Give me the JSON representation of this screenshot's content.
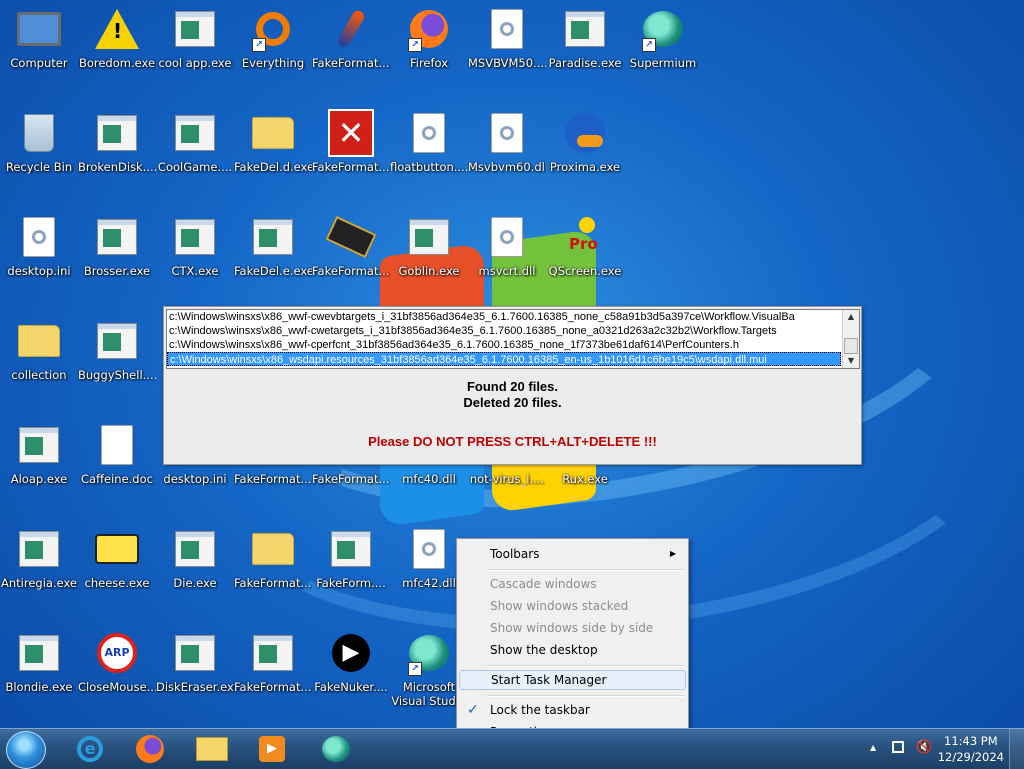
{
  "desktop": {
    "icons": [
      {
        "label": "Computer",
        "kind": "monitor"
      },
      {
        "label": "Boredom.exe",
        "kind": "warn"
      },
      {
        "label": "cool app.exe",
        "kind": "app"
      },
      {
        "label": "Everything",
        "kind": "ring",
        "shortcut": true
      },
      {
        "label": "FakeFormat....",
        "kind": "torch"
      },
      {
        "label": "Firefox",
        "kind": "fox",
        "shortcut": true
      },
      {
        "label": "MSVBVM50....",
        "kind": "gear"
      },
      {
        "label": "Paradise.exe",
        "kind": "app"
      },
      {
        "label": "Supermium",
        "kind": "orb",
        "shortcut": true
      },
      {
        "label": "Recycle Bin",
        "kind": "bin"
      },
      {
        "label": "BrokenDisk....",
        "kind": "app"
      },
      {
        "label": "CoolGame....",
        "kind": "app"
      },
      {
        "label": "FakeDel.d.exe",
        "kind": "folder"
      },
      {
        "label": "FakeFormat....",
        "kind": "redx"
      },
      {
        "label": "floatbutton....",
        "kind": "gear"
      },
      {
        "label": "Msvbvm60.dll",
        "kind": "gear"
      },
      {
        "label": "Proxima.exe",
        "kind": "duck"
      },
      {
        "label": "desktop.ini",
        "kind": "gear"
      },
      {
        "label": "Brosser.exe",
        "kind": "app"
      },
      {
        "label": "CTX.exe",
        "kind": "app"
      },
      {
        "label": "FakeDel.e.exe",
        "kind": "app"
      },
      {
        "label": "FakeFormat....",
        "kind": "chip"
      },
      {
        "label": "Goblin.exe",
        "kind": "app"
      },
      {
        "label": "msvcrt.dll",
        "kind": "gear"
      },
      {
        "label": "QScreen.exe",
        "kind": "qscreen"
      },
      {
        "label": "collection",
        "kind": "folder"
      },
      {
        "label": "BuggyShell....",
        "kind": "app"
      },
      {
        "label": "Aloap.exe",
        "kind": "app"
      },
      {
        "label": "Caffeine.doc",
        "kind": "doc"
      },
      {
        "label": "desktop.ini",
        "kind": "gear"
      },
      {
        "label": "FakeFormat....",
        "kind": "app"
      },
      {
        "label": "FakeFormat....",
        "kind": "app"
      },
      {
        "label": "mfc40.dll",
        "kind": "gear"
      },
      {
        "label": "not-virus_i....",
        "kind": "app"
      },
      {
        "label": "Rux.exe",
        "kind": "app"
      },
      {
        "label": "Antiregia.exe",
        "kind": "app"
      },
      {
        "label": "cheese.exe",
        "kind": "cheese"
      },
      {
        "label": "Die.exe",
        "kind": "app"
      },
      {
        "label": "FakeFormat....",
        "kind": "folder"
      },
      {
        "label": "FakeForm....",
        "kind": "app"
      },
      {
        "label": "mfc42.dll",
        "kind": "gear"
      },
      {
        "label": "Blondie.exe",
        "kind": "app"
      },
      {
        "label": "CloseMouse....",
        "kind": "noentry"
      },
      {
        "label": "DiskEraser.exe",
        "kind": "app"
      },
      {
        "label": "FakeFormat....",
        "kind": "app"
      },
      {
        "label": "FakeNuker....",
        "kind": "black"
      },
      {
        "label": "Microsoft Visual Stud...",
        "kind": "orb",
        "shortcut": true
      }
    ]
  },
  "console": {
    "rows": [
      "c:\\Windows\\winsxs\\x86_wwf-cwevbtargets_i_31bf3856ad364e35_6.1.7600.16385_none_c58a91b3d5a397ce\\Workflow.VisualBa",
      "c:\\Windows\\winsxs\\x86_wwf-cwetargets_i_31bf3856ad364e35_6.1.7600.16385_none_a0321d263a2c32b2\\Workflow.Targets",
      "c:\\Windows\\winsxs\\x86_wwf-cperfcnt_31bf3856ad364e35_6.1.7600.16385_none_1f7373be61daf614\\PerfCounters.h",
      "c:\\Windows\\winsxs\\x86_wsdapi.resources_31bf3856ad364e35_6.1.7600.16385_en-us_1b1016d1c6be19c5\\wsdapi.dll.mui"
    ],
    "found": "Found 20 files.",
    "deleted": "Deleted 20 files.",
    "warning": "Please DO NOT PRESS CTRL+ALT+DELETE !!!"
  },
  "context_menu": {
    "toolbars": "Toolbars",
    "cascade": "Cascade windows",
    "stacked": "Show windows stacked",
    "side_by_side": "Show windows side by side",
    "show_desktop": "Show the desktop",
    "task_manager": "Start Task Manager",
    "lock_taskbar": "Lock the taskbar",
    "properties": "Properties"
  },
  "taskbar": {
    "time": "11:43 PM",
    "date": "12/29/2024"
  },
  "colors": {
    "warning_text": "#c00000",
    "selection": "#3399ff"
  }
}
